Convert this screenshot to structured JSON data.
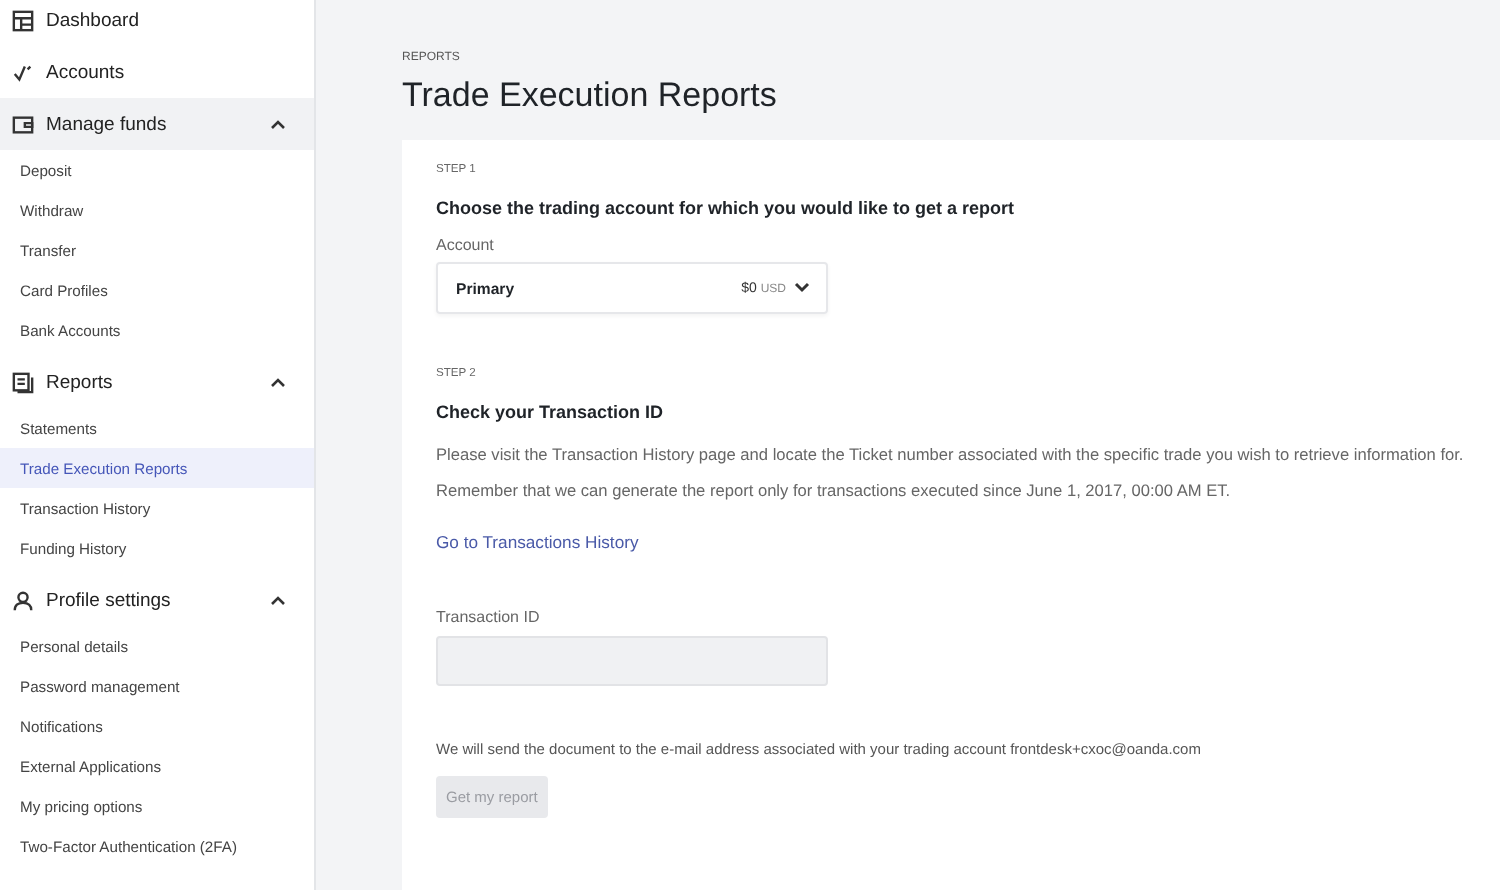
{
  "sidebar": {
    "items": [
      {
        "kind": "link",
        "label": "Dashboard",
        "selected": false
      },
      {
        "kind": "link",
        "label": "Accounts",
        "selected": false
      },
      {
        "kind": "section",
        "label": "Manage funds",
        "expanded": true,
        "hovered": true,
        "children": [
          {
            "label": "Deposit",
            "selected": false
          },
          {
            "label": "Withdraw",
            "selected": false
          },
          {
            "label": "Transfer",
            "selected": false
          },
          {
            "label": "Card Profiles",
            "selected": false
          },
          {
            "label": "Bank Accounts",
            "selected": false
          }
        ]
      },
      {
        "kind": "section",
        "label": "Reports",
        "expanded": true,
        "hovered": false,
        "children": [
          {
            "label": "Statements",
            "selected": false
          },
          {
            "label": "Trade Execution Reports",
            "selected": true
          },
          {
            "label": "Transaction History",
            "selected": false
          },
          {
            "label": "Funding History",
            "selected": false
          }
        ]
      },
      {
        "kind": "section",
        "label": "Profile settings",
        "expanded": true,
        "hovered": false,
        "children": [
          {
            "label": "Personal details",
            "selected": false
          },
          {
            "label": "Password management",
            "selected": false
          },
          {
            "label": "Notifications",
            "selected": false
          },
          {
            "label": "External Applications",
            "selected": false
          },
          {
            "label": "My pricing options",
            "selected": false
          },
          {
            "label": "Two-Factor Authentication (2FA)",
            "selected": false
          }
        ]
      }
    ]
  },
  "breadcrumb": "REPORTS",
  "title": "Trade Execution Reports",
  "step1": {
    "step": "STEP 1",
    "heading": "Choose the trading account for which you would like to get a report",
    "account_label": "Account",
    "account": {
      "name": "Primary",
      "amount": "$0",
      "currency": "USD"
    }
  },
  "step2": {
    "step": "STEP 2",
    "heading": "Check your Transaction ID",
    "text": "Please visit the Transaction History page and locate the Ticket number associated with the specific trade you wish to retrieve information for. Remember that we can generate the report only for transactions executed since June 1, 2017, 00:00 AM ET.",
    "link": "Go to Transactions History",
    "field_label": "Transaction ID"
  },
  "email_note": "We will send the document to the e-mail address associated with your trading account frontdesk+cxoc@oanda.com",
  "submit": {
    "label": "Get my report",
    "disabled": true
  }
}
